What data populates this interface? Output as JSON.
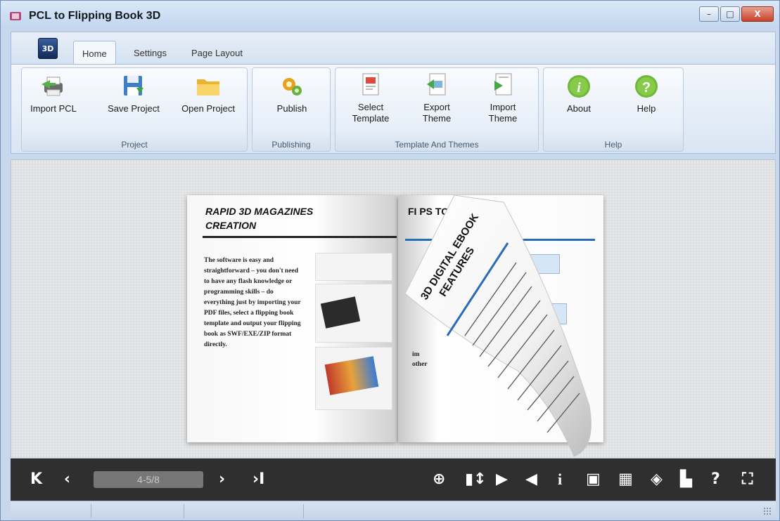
{
  "window": {
    "title": "PCL to Flipping Book 3D",
    "minimize": "–",
    "maximize": "□",
    "close": "X"
  },
  "ribbon": {
    "app_button": "3D",
    "tabs": [
      {
        "label": "Home",
        "active": true
      },
      {
        "label": "Settings"
      },
      {
        "label": "Page Layout"
      }
    ],
    "groups": {
      "project": {
        "label": "Project",
        "buttons": [
          {
            "label": "Import PCL",
            "icon": "printer-icon"
          },
          {
            "label": "Save Project",
            "icon": "save-disk-icon"
          },
          {
            "label": "Open Project",
            "icon": "folder-icon"
          }
        ]
      },
      "publishing": {
        "label": "Publishing",
        "buttons": [
          {
            "label": "Publish",
            "icon": "gears-icon"
          }
        ]
      },
      "template": {
        "label": "Template And Themes",
        "buttons": [
          {
            "label1": "Select",
            "label2": "Template",
            "icon": "template-icon"
          },
          {
            "label1": "Export",
            "label2": "Theme",
            "icon": "export-theme-icon"
          },
          {
            "label1": "Import",
            "label2": "Theme",
            "icon": "import-theme-icon"
          }
        ]
      },
      "help": {
        "label": "Help",
        "buttons": [
          {
            "label": "About",
            "icon": "info-icon"
          },
          {
            "label": "Help",
            "icon": "question-icon"
          }
        ]
      }
    }
  },
  "book": {
    "left_title1": "RAPID 3D MAGAZINES",
    "left_title2": "CREATION",
    "left_body": [
      "The software is easy and",
      "straightforward – you don't need",
      "to have any flash knowledge or",
      "programming skills – do",
      "everything just by importing your",
      "PDF files, select a flipping book",
      "template and output your flipping",
      "book as SWF/EXE/ZIP format",
      "directly."
    ],
    "right_title": "FI    PS TO CREATE",
    "right_fragment1": "im",
    "right_fragment2": "other",
    "curl_title1": "3D DIGITAL EBOOK",
    "curl_title2": "FEATURES"
  },
  "viewer": {
    "page_indicator": "4-5/8",
    "colors": {
      "toolbar_bg": "#2f2f2f",
      "accent_blue": "#2a6bb8"
    }
  }
}
